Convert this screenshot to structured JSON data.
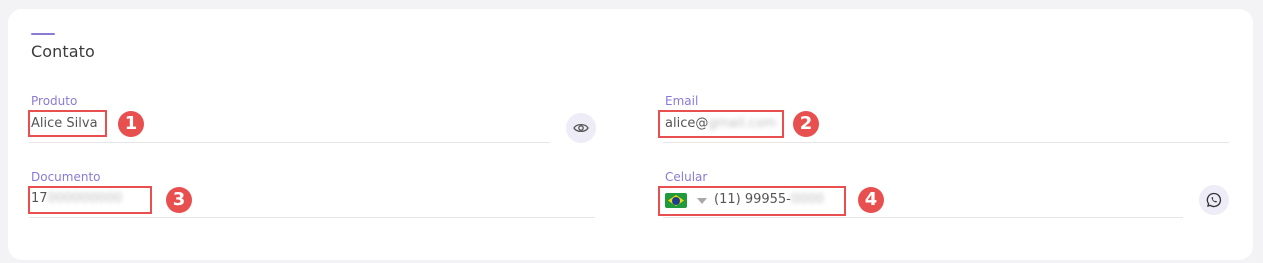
{
  "section": {
    "title": "Contato"
  },
  "fields": {
    "produto": {
      "label": "Produto",
      "value": "Alice Silva",
      "badge": "1"
    },
    "email": {
      "label": "Email",
      "value_visible": "alice@",
      "value_masked": "gmail.com",
      "badge": "2"
    },
    "documento": {
      "label": "Documento",
      "value_visible": "17",
      "value_masked": "000000000",
      "badge": "3"
    },
    "celular": {
      "label": "Celular",
      "value_visible": "(11) 99955-",
      "value_masked": "0000",
      "country": "BR",
      "badge": "4"
    }
  },
  "icons": {
    "reveal": "eye-icon",
    "whatsapp": "whatsapp-icon",
    "country_flag": "brazil-flag-icon",
    "dropdown": "caret-down-icon"
  },
  "colors": {
    "accent": "#8a7bd6",
    "highlight": "#e8504f",
    "icon_bg": "#eeecf7"
  }
}
